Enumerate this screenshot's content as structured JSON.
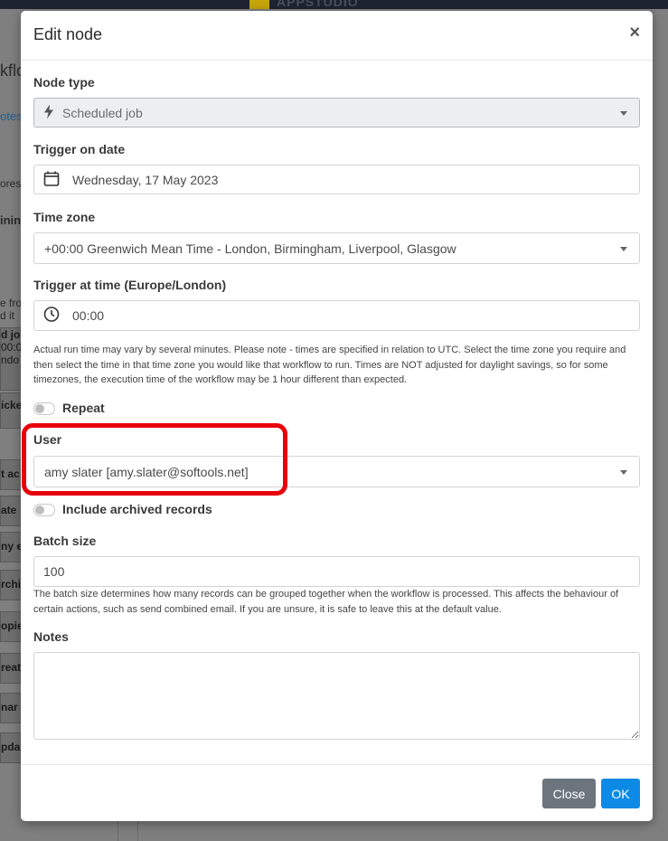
{
  "background": {
    "brand_text": "APPSTUDIO",
    "page_title": "kflo",
    "link_text": "otes",
    "hint_a": "ores",
    "hint_b": "inin",
    "hint_c_line1": "e fro",
    "hint_c_line2": "d it",
    "nodes": [
      {
        "text": "d jo",
        "sub1": "00:0",
        "sub2": "ndo"
      },
      {
        "text": "icke"
      },
      {
        "text": "t ac"
      },
      {
        "text": "ate"
      },
      {
        "text": "ny e"
      },
      {
        "text": "rchi"
      },
      {
        "text": "opie"
      },
      {
        "text": "reat"
      },
      {
        "text": "nar"
      },
      {
        "text": "pda"
      }
    ]
  },
  "modal": {
    "title": "Edit node",
    "close_glyph": "×",
    "node_type": {
      "label": "Node type",
      "value": "Scheduled job",
      "icon": "bolt-icon"
    },
    "trigger_date": {
      "label": "Trigger on date",
      "value": "Wednesday, 17 May 2023",
      "icon": "calendar-icon"
    },
    "time_zone": {
      "label": "Time zone",
      "value": "+00:00 Greenwich Mean Time - London, Birmingham, Liverpool, Glasgow"
    },
    "trigger_time": {
      "label": "Trigger at time (Europe/London)",
      "value": "00:00",
      "icon": "clock-icon",
      "help": "Actual run time may vary by several minutes. Please note - times are specified in relation to UTC. Select the time zone you require and then select the time in that time zone you would like that workflow to run. Times are NOT adjusted for daylight savings, so for some timezones, the execution time of the workflow may be 1 hour different than expected."
    },
    "repeat": {
      "label": "Repeat",
      "checked": false
    },
    "user": {
      "label": "User",
      "value": "amy slater [amy.slater@softools.net]",
      "highlight_color": "#e8000b"
    },
    "include_archived": {
      "label": "Include archived records",
      "checked": false
    },
    "batch_size": {
      "label": "Batch size",
      "value": "100",
      "help": "The batch size determines how many records can be grouped together when the workflow is processed. This affects the behaviour of certain actions, such as send combined email. If you are unsure, it is safe to leave this at the default value."
    },
    "notes": {
      "label": "Notes",
      "value": ""
    },
    "buttons": {
      "close": "Close",
      "ok": "OK"
    },
    "colors": {
      "primary": "#0d8ae6",
      "secondary": "#6c757d"
    }
  }
}
